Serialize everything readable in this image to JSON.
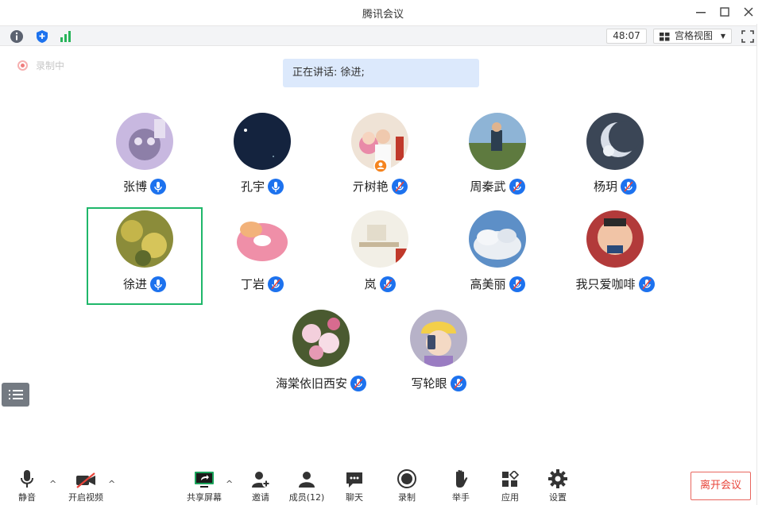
{
  "window": {
    "title": "腾讯会议"
  },
  "topbar": {
    "timer": "48:07",
    "view_label": "宫格视图"
  },
  "recording": {
    "label": "录制中"
  },
  "speaking": {
    "text": "正在讲话: 徐进;"
  },
  "participants": [
    {
      "name": "张博",
      "mic": "on"
    },
    {
      "name": "孔宇",
      "mic": "on"
    },
    {
      "name": "亓树艳",
      "mic": "muted"
    },
    {
      "name": "周秦武",
      "mic": "muted"
    },
    {
      "name": "杨玥",
      "mic": "muted"
    },
    {
      "name": "徐进",
      "mic": "on",
      "active_speaker": true
    },
    {
      "name": "丁岩",
      "mic": "muted"
    },
    {
      "name": "岚",
      "mic": "muted"
    },
    {
      "name": "高美丽",
      "mic": "muted"
    },
    {
      "name": "我只爱咖啡",
      "mic": "muted"
    },
    {
      "name": "海棠依旧西安",
      "mic": "muted"
    },
    {
      "name": "写轮眼",
      "mic": "muted"
    }
  ],
  "toolbar": {
    "mute": "静音",
    "video": "开启视频",
    "share": "共享屏幕",
    "invite": "邀请",
    "members": "成员(12)",
    "chat": "聊天",
    "record": "录制",
    "raise_hand": "举手",
    "apps": "应用",
    "settings": "设置",
    "leave": "离开会议"
  },
  "icons": [
    "info-icon",
    "shield-icon",
    "signal-icon",
    "grid-view-icon",
    "fullscreen-icon",
    "minimize-icon",
    "maximize-icon",
    "close-icon",
    "mic-icon",
    "video-off-icon",
    "share-screen-icon",
    "invite-icon",
    "members-icon",
    "chat-icon",
    "record-icon",
    "raise-hand-icon",
    "apps-icon",
    "settings-icon",
    "list-menu-icon"
  ],
  "colors": {
    "accent": "#1d72ee",
    "active_border": "#1fb76a",
    "speaking_banner": "#dce9fc",
    "leave": "#e8443a"
  }
}
